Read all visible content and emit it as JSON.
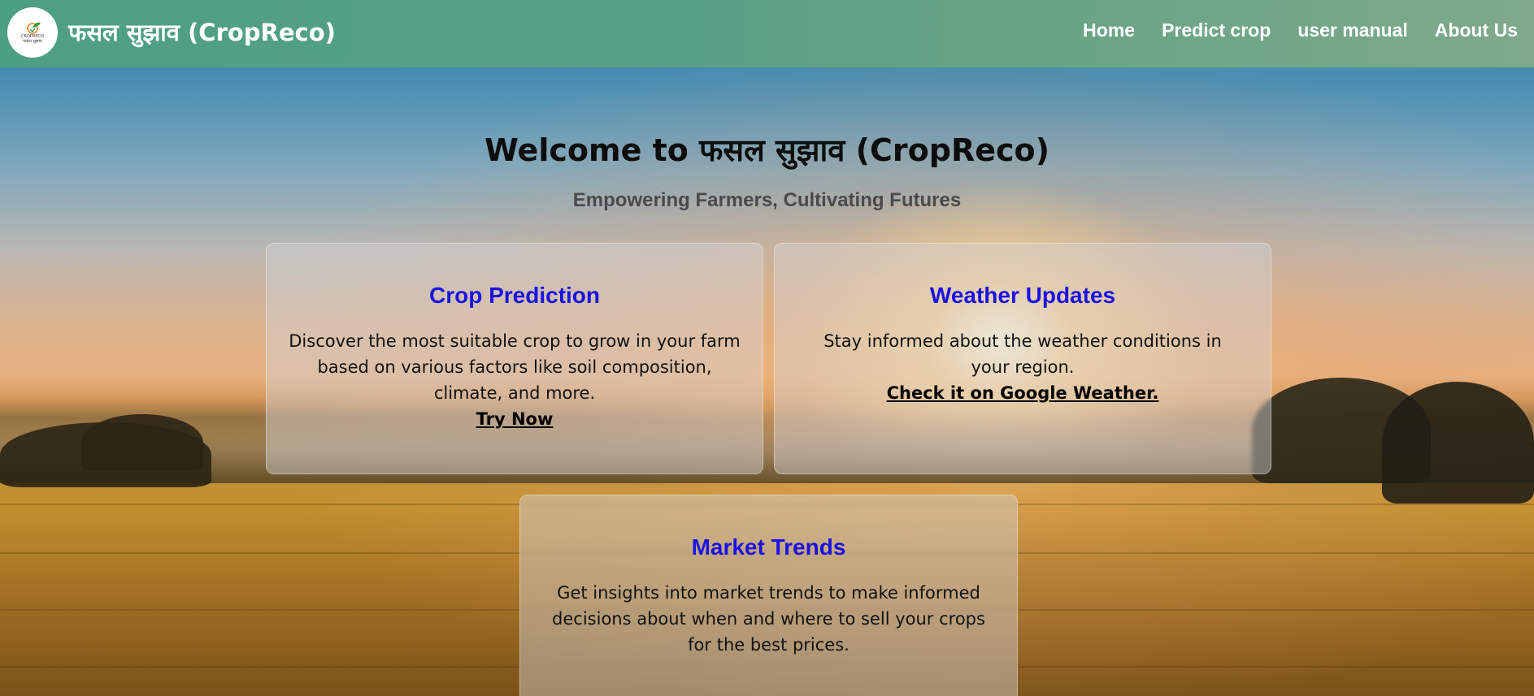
{
  "header": {
    "brand": "फसल सुझाव (CropReco)",
    "logo_text_line1": "CROPRECO",
    "logo_text_line2": "फसल सुझाव",
    "nav": [
      "Home",
      "Predict crop",
      "user manual",
      "About Us"
    ]
  },
  "hero": {
    "title": "Welcome to फसल सुझाव (CropReco)",
    "subtitle": "Empowering Farmers, Cultivating Futures"
  },
  "cards": [
    {
      "title": "Crop Prediction",
      "description": "Discover the most suitable crop to grow in your farm based on various factors like soil composition, climate, and more.",
      "link": "Try Now"
    },
    {
      "title": "Weather Updates",
      "description": "Stay informed about the weather conditions in your region.",
      "link": "Check it on Google Weather."
    },
    {
      "title": "Market Trends",
      "description": "Get insights into market trends to make informed decisions about when and where to sell your crops for the best prices."
    }
  ],
  "colors": {
    "navbar": "#58a084",
    "card_title": "#1a12e8",
    "hero_title": "#0d0d0d",
    "hero_subtitle": "#4a4a4a"
  }
}
